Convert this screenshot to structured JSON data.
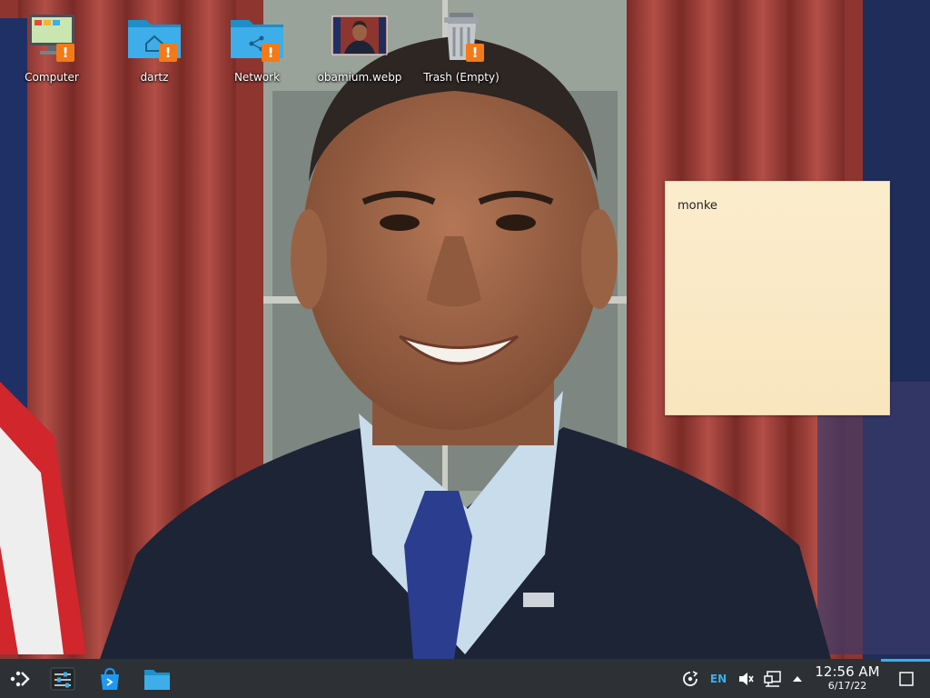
{
  "desktop": {
    "wallpaper": "portrait-photo-wallpaper",
    "icons": [
      {
        "label": "Computer",
        "icon": "computer-icon"
      },
      {
        "label": "dartz",
        "icon": "home-folder-icon"
      },
      {
        "label": "Network",
        "icon": "network-folder-icon"
      },
      {
        "label": "obamium.webp",
        "icon": "image-thumbnail-icon"
      },
      {
        "label": "Trash (Empty)",
        "icon": "trash-icon"
      }
    ],
    "badge_symbol": "!",
    "badge_color": "#f27a1a"
  },
  "note": {
    "text": "monke",
    "background": "#fbeccd"
  },
  "taskbar": {
    "background": "#2d3136",
    "accent": "#3daee9",
    "launchers": [
      {
        "icon": "application-launcher-icon"
      },
      {
        "icon": "system-settings-icon"
      },
      {
        "icon": "discover-store-icon"
      },
      {
        "icon": "file-manager-icon"
      }
    ],
    "tray": {
      "language": "EN",
      "icons": [
        "updates-icon",
        "volume-muted-icon",
        "network-icon",
        "expand-tray-icon"
      ]
    },
    "clock": {
      "time": "12:56 AM",
      "date": "6/17/22"
    },
    "show_desktop_icon": "show-desktop-icon"
  }
}
